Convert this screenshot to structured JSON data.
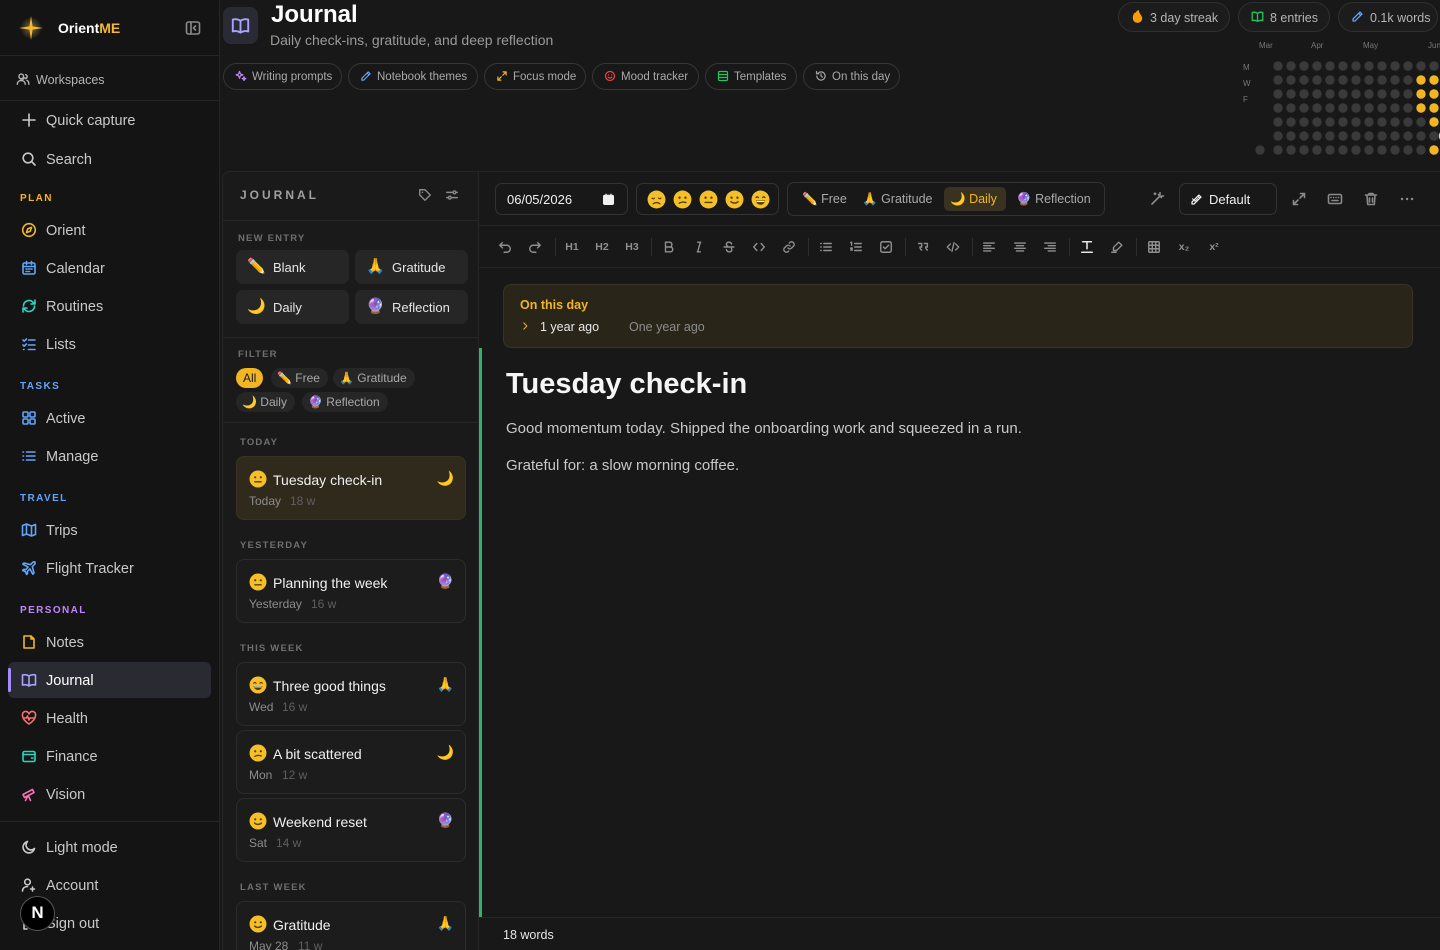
{
  "brand": {
    "name_a": "Orient",
    "name_b": "ME"
  },
  "sidebar": {
    "workspaces": "Workspaces",
    "top": [
      {
        "label": "Quick capture",
        "icon": "plus-icon"
      },
      {
        "label": "Search",
        "icon": "search-icon"
      }
    ],
    "sections": [
      {
        "title": "PLAN",
        "color": "#f2b524",
        "items": [
          {
            "label": "Orient",
            "icon": "compass-icon"
          },
          {
            "label": "Calendar",
            "icon": "calendar-icon"
          },
          {
            "label": "Routines",
            "icon": "refresh-icon"
          },
          {
            "label": "Lists",
            "icon": "list-check-icon"
          }
        ]
      },
      {
        "title": "TASKS",
        "color": "#60a5fa",
        "items": [
          {
            "label": "Active",
            "icon": "grid-icon"
          },
          {
            "label": "Manage",
            "icon": "list-icon"
          }
        ]
      },
      {
        "title": "TRAVEL",
        "color": "#60a5fa",
        "items": [
          {
            "label": "Trips",
            "icon": "map-icon"
          },
          {
            "label": "Flight Tracker",
            "icon": "plane-icon"
          }
        ]
      },
      {
        "title": "PERSONAL",
        "color": "#c084fc",
        "items": [
          {
            "label": "Notes",
            "icon": "note-icon"
          },
          {
            "label": "Journal",
            "icon": "book-icon",
            "active": true
          },
          {
            "label": "Health",
            "icon": "heart-pulse-icon"
          },
          {
            "label": "Finance",
            "icon": "wallet-icon"
          },
          {
            "label": "Vision",
            "icon": "telescope-icon"
          }
        ]
      }
    ],
    "bottom": [
      {
        "label": "Light mode",
        "icon": "moon-icon"
      },
      {
        "label": "Account",
        "icon": "user-icon"
      },
      {
        "label": "Sign out",
        "icon": "logout-icon"
      }
    ]
  },
  "header": {
    "title": "Journal",
    "subtitle": "Daily check-ins, gratitude, and deep reflection",
    "stats": [
      {
        "label": "3 day streak",
        "icon": "flame-icon",
        "color": "#f59e0b"
      },
      {
        "label": "8 entries",
        "icon": "book-open-icon",
        "color": "#22c55e"
      },
      {
        "label": "0.1k words",
        "icon": "pen-icon",
        "color": "#60a5fa"
      }
    ],
    "pills": [
      {
        "label": "Writing prompts",
        "icon": "sparkles-icon",
        "color": "#c084fc"
      },
      {
        "label": "Notebook themes",
        "icon": "pen-icon",
        "color": "#60a5fa"
      },
      {
        "label": "Focus mode",
        "icon": "expand-icon",
        "color": "#f2b524"
      },
      {
        "label": "Mood tracker",
        "icon": "smile-icon",
        "color": "#ef4444"
      },
      {
        "label": "Templates",
        "icon": "layout-icon",
        "color": "#22c55e"
      },
      {
        "label": "On this day",
        "icon": "history-icon",
        "color": "#a0a0a0"
      }
    ],
    "heatmap": {
      "months": [
        "Mar",
        "Apr",
        "May",
        "Jun"
      ],
      "days": [
        "M",
        "W",
        "F"
      ]
    }
  },
  "journal_panel": {
    "title": "JOURNAL",
    "new_entry_caption": "NEW ENTRY",
    "new_entry": [
      {
        "emoji": "✏️",
        "label": "Blank"
      },
      {
        "emoji": "🙏",
        "label": "Gratitude"
      },
      {
        "emoji": "🌙",
        "label": "Daily"
      },
      {
        "emoji": "🔮",
        "label": "Reflection"
      }
    ],
    "filter_caption": "FILTER",
    "filters": [
      {
        "label": "All",
        "active": true
      },
      {
        "emoji": "✏️",
        "label": "Free"
      },
      {
        "emoji": "🙏",
        "label": "Gratitude"
      },
      {
        "emoji": "🌙",
        "label": "Daily"
      },
      {
        "emoji": "🔮",
        "label": "Reflection"
      }
    ],
    "groups": [
      {
        "caption": "TODAY",
        "entries": [
          {
            "title": "Tuesday check-in",
            "date": "Today",
            "words": "18 w",
            "mood": "neutral",
            "type": "🌙",
            "selected": true
          }
        ]
      },
      {
        "caption": "YESTERDAY",
        "entries": [
          {
            "title": "Planning the week",
            "date": "Yesterday",
            "words": "16 w",
            "mood": "neutral",
            "type": "🔮"
          }
        ]
      },
      {
        "caption": "THIS WEEK",
        "entries": [
          {
            "title": "Three good things",
            "date": "Wed",
            "words": "16 w",
            "mood": "grin",
            "type": "🙏"
          },
          {
            "title": "A bit scattered",
            "date": "Mon",
            "words": "12 w",
            "mood": "confused",
            "type": "🌙"
          },
          {
            "title": "Weekend reset",
            "date": "Sat",
            "words": "14 w",
            "mood": "smile",
            "type": "🔮"
          }
        ]
      },
      {
        "caption": "LAST WEEK",
        "entries": [
          {
            "title": "Gratitude",
            "date": "May 28",
            "words": "11 w",
            "mood": "smile",
            "type": "🙏"
          }
        ]
      }
    ]
  },
  "editor": {
    "date": "06/05/2026",
    "moods": [
      "sad",
      "confused",
      "neutral",
      "smile",
      "grin"
    ],
    "types": [
      {
        "emoji": "✏️",
        "label": "Free"
      },
      {
        "emoji": "🙏",
        "label": "Gratitude"
      },
      {
        "emoji": "🌙",
        "label": "Daily",
        "active": true
      },
      {
        "emoji": "🔮",
        "label": "Reflection"
      }
    ],
    "template": "Default",
    "format_labels": {
      "h1": "H1",
      "h2": "H2",
      "h3": "H3",
      "sub": "x₂",
      "sup": "x²"
    },
    "on_this_day": {
      "heading": "On this day",
      "ago": "1 year ago",
      "desc": "One year ago"
    },
    "entry_title": "Tuesday check-in",
    "paragraphs": [
      "Good momentum today. Shipped the onboarding work and squeezed in a run.",
      "Grateful for: a slow morning coffee."
    ],
    "word_count": "18 words"
  },
  "badge": "N"
}
